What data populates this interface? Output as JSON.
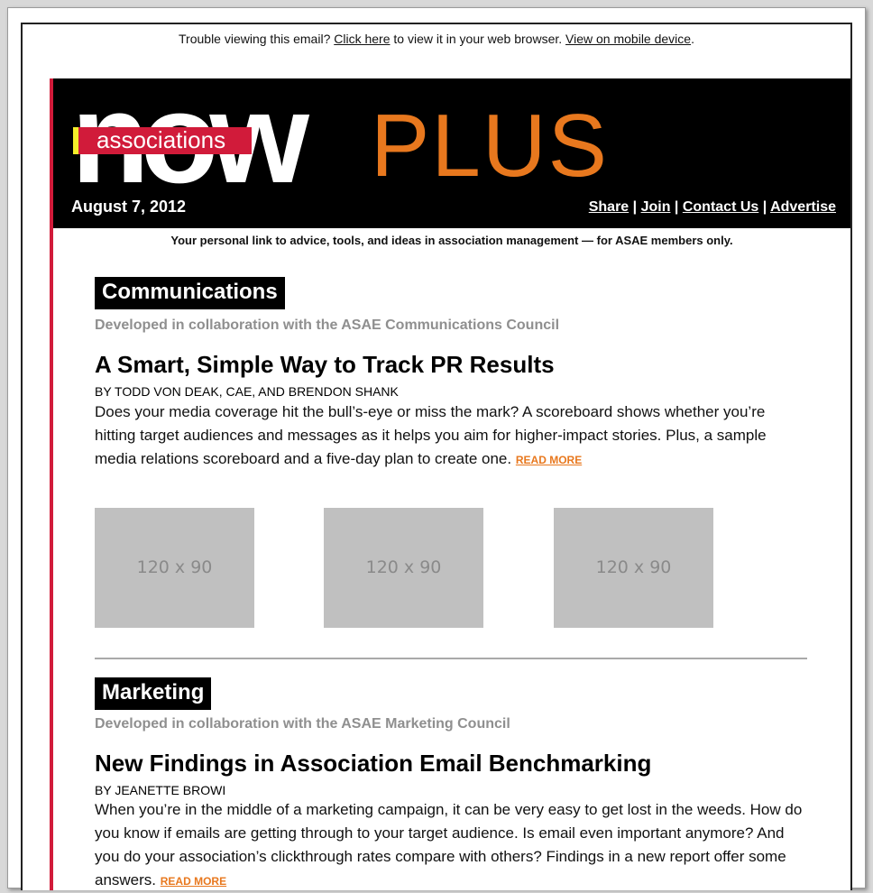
{
  "topline": {
    "prefix": "Trouble viewing this email? ",
    "click_here": "Click here",
    "middle": " to view it in your web browser. ",
    "mobile": "View on mobile device",
    "suffix": "."
  },
  "banner": {
    "logo_now": "now",
    "logo_associations": "associations",
    "logo_plus": "PLUS",
    "date": "August 7, 2012",
    "nav": [
      "Share",
      "Join",
      "Contact Us",
      "Advertise"
    ],
    "nav_sep": " | "
  },
  "tagline": "Your personal link to advice, tools, and ideas in association management — for ASAE members only.",
  "sections": [
    {
      "heading": "Communications",
      "subheading": "Developed in collaboration with the ASAE Communications Council",
      "title": "A Smart, Simple Way to Track PR Results",
      "byline": "BY TODD VON DEAK, CAE, AND BRENDON SHANK",
      "body": "Does your media coverage hit the bull’s-eye or miss the mark? A scoreboard shows whether you’re hitting target audiences and messages as it helps you aim for higher-impact stories. Plus, a sample media relations scoreboard and a five-day plan to create one.",
      "read_more": "READ MORE",
      "thumbnails": [
        "120 x 90",
        "120 x 90",
        "120 x 90"
      ]
    },
    {
      "heading": "Marketing",
      "subheading": "Developed in collaboration with the ASAE Marketing Council",
      "title": "New Findings in Association Email Benchmarking",
      "byline": "BY JEANETTE BROWI",
      "body": "When you’re in the middle of a marketing campaign, it can be very easy to get lost in the weeds. How do you know if emails are getting through to your target audience. Is email even important anymore? And you do your association’s clickthrough rates compare with others? Findings in a new report offer some answers.",
      "read_more": "READ MORE"
    }
  ],
  "colors": {
    "accent_red": "#d11b3a",
    "accent_orange": "#e8781e",
    "accent_yellow": "#f4ee2a",
    "subheading_gray": "#8f8f8f"
  }
}
